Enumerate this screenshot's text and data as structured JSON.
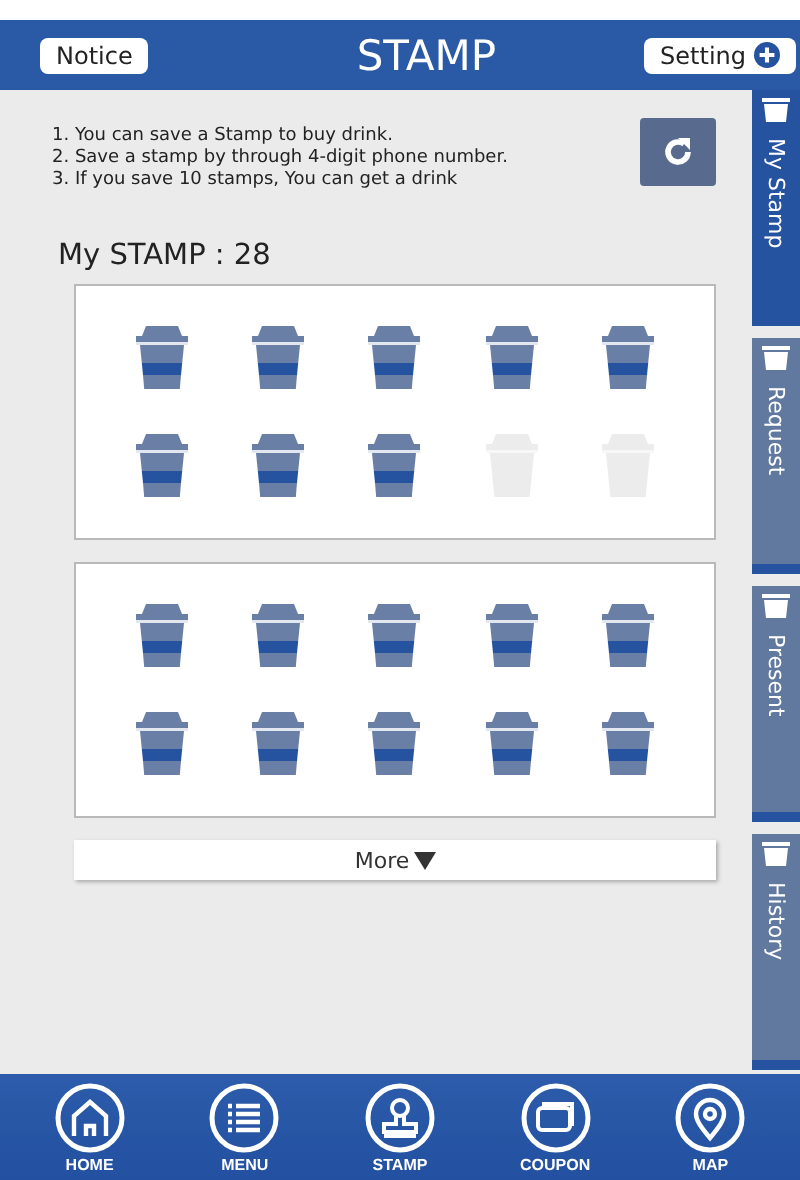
{
  "header": {
    "title": "STAMP",
    "left_button": "Notice",
    "right_button": "Setting"
  },
  "instructions": [
    "1. You can save a Stamp to buy drink.",
    "2. Save a stamp by through 4-digit phone number.",
    "3. If you save 10 stamps, You can get a drink"
  ],
  "stamp_count_label": "My STAMP : 28",
  "cards": [
    {
      "stamps": [
        {
          "filled": true
        },
        {
          "filled": true
        },
        {
          "filled": true
        },
        {
          "filled": true
        },
        {
          "filled": true
        },
        {
          "filled": true
        },
        {
          "filled": true
        },
        {
          "filled": true
        },
        {
          "filled": false
        },
        {
          "filled": false
        }
      ]
    },
    {
      "stamps": [
        {
          "filled": true
        },
        {
          "filled": true
        },
        {
          "filled": true
        },
        {
          "filled": true
        },
        {
          "filled": true
        },
        {
          "filled": true
        },
        {
          "filled": true
        },
        {
          "filled": true
        },
        {
          "filled": true
        },
        {
          "filled": true
        }
      ]
    }
  ],
  "more_button": "More",
  "side_tabs": [
    {
      "label": "My Stamp",
      "selected": true
    },
    {
      "label": "Request",
      "selected": false
    },
    {
      "label": "Present",
      "selected": false
    },
    {
      "label": "History",
      "selected": false
    }
  ],
  "bottom_nav": [
    {
      "label": "HOME",
      "kind": "home"
    },
    {
      "label": "MENU",
      "kind": "menu"
    },
    {
      "label": "STAMP",
      "kind": "stamp"
    },
    {
      "label": "COUPON",
      "kind": "coupon"
    },
    {
      "label": "MAP",
      "kind": "map"
    }
  ]
}
